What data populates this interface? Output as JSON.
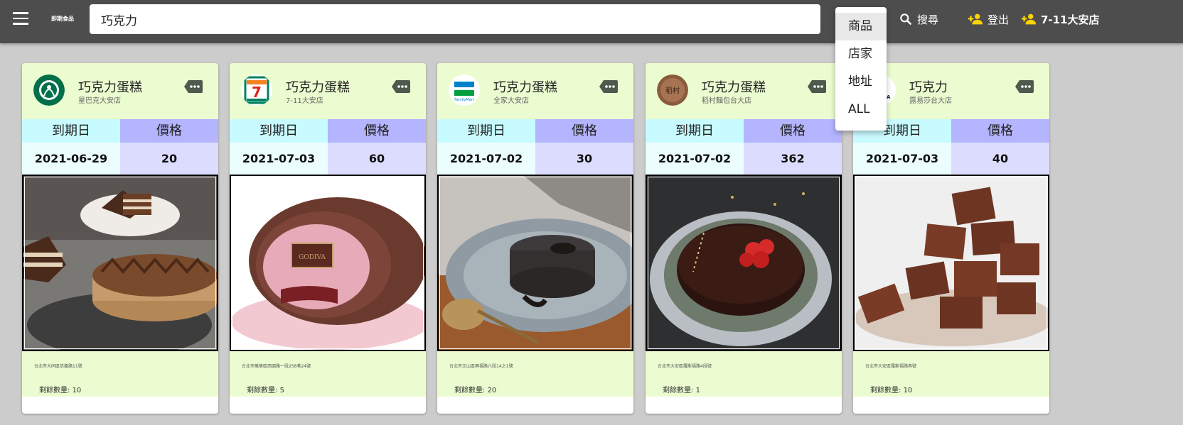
{
  "header": {
    "logo_text": "即期食品",
    "search_value": "巧克力",
    "search_label": "搜尋",
    "logout_label": "登出",
    "store_label": "7-11大安店"
  },
  "dropdown": {
    "options": [
      "商品",
      "店家",
      "地址",
      "ALL"
    ],
    "selected": "商品"
  },
  "table_headers": {
    "expiry": "到期日",
    "price": "價格"
  },
  "quantity_prefix": "剩餘數量:",
  "cards": [
    {
      "title": "巧克力蛋糕",
      "store": "星巴克大安店",
      "logo": "starbucks-logo",
      "expiry": "2021-06-29",
      "price": "20",
      "image": "chocolate-layer-cake-photo",
      "address": "台北市大同區信義路11號",
      "quantity": "10",
      "colors": {
        "logo": "#00704a"
      }
    },
    {
      "title": "巧克力蛋糕",
      "store": "7-11大安店",
      "logo": "7-eleven-logo",
      "expiry": "2021-07-03",
      "price": "60",
      "image": "godiva-roll-cake-photo",
      "address": "台北市萬華區西園路一段258巷24號",
      "quantity": "5",
      "colors": {
        "logo": "#008061"
      }
    },
    {
      "title": "巧克力蛋糕",
      "store": "全家大安店",
      "logo": "familymart-logo",
      "expiry": "2021-07-02",
      "price": "30",
      "image": "lava-cake-photo",
      "address": "台北市文山區興福路六段14之1號",
      "quantity": "20",
      "colors": {
        "logo": "#0080cb"
      }
    },
    {
      "title": "巧克力蛋糕",
      "store": "稻村麵包台大店",
      "logo": "bakery-logo",
      "expiry": "2021-07-02",
      "price": "362",
      "image": "strawberry-chocolate-cake-photo",
      "address": "台北市大安區羅斯福路4段號",
      "quantity": "1",
      "colors": {
        "logo": "#8b5a3c"
      }
    },
    {
      "title": "巧克力",
      "store": "露易莎台大店",
      "logo": "louisa-logo",
      "expiry": "2021-07-03",
      "price": "40",
      "image": "chocolate-truffle-cubes-photo",
      "address": "台北市大安區羅斯福路巷號",
      "quantity": "10",
      "colors": {
        "logo": "#f06a1d"
      }
    }
  ]
}
